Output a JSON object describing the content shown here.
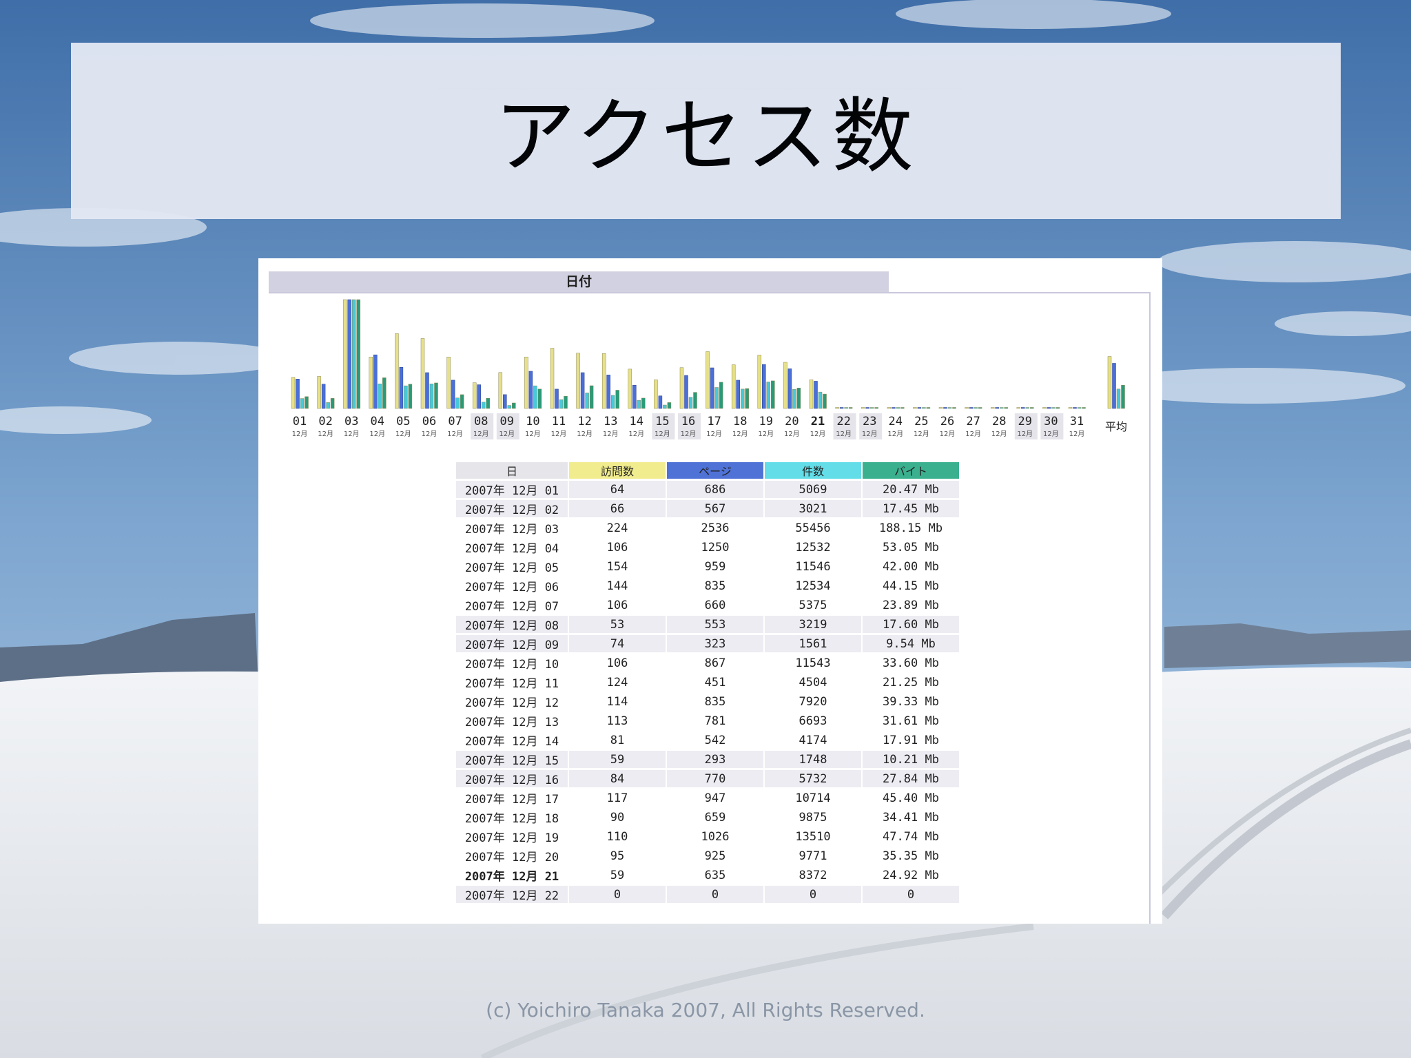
{
  "slide": {
    "title": "アクセス数",
    "footer": "(c) Yoichiro Tanaka 2007, All Rights Reserved."
  },
  "screenshot": {
    "date_header": "日付",
    "average_label": "平均",
    "month_label": "12月"
  },
  "colors": {
    "visits": "#e6e08a",
    "pages": "#4a6fd8",
    "hits": "#48c9d8",
    "bytes": "#2a9a78",
    "header_visits": "#f1ec8e",
    "header_pages": "#4f72d6",
    "header_hits": "#63dde8",
    "header_bytes": "#3ab08f"
  },
  "chart_data": {
    "type": "bar",
    "title": "",
    "categories": [
      "01",
      "02",
      "03",
      "04",
      "05",
      "06",
      "07",
      "08",
      "09",
      "10",
      "11",
      "12",
      "13",
      "14",
      "15",
      "16",
      "17",
      "18",
      "19",
      "20",
      "21",
      "22",
      "23",
      "24",
      "25",
      "26",
      "27",
      "28",
      "29",
      "30",
      "31"
    ],
    "series": [
      {
        "name": "訪問数",
        "values": [
          64,
          66,
          224,
          106,
          154,
          144,
          106,
          53,
          74,
          106,
          124,
          114,
          113,
          81,
          59,
          84,
          117,
          90,
          110,
          95,
          59,
          0,
          0,
          0,
          0,
          0,
          0,
          0,
          0,
          0,
          0
        ]
      },
      {
        "name": "ページ",
        "values": [
          686,
          567,
          2536,
          1250,
          959,
          835,
          660,
          553,
          323,
          867,
          451,
          835,
          781,
          542,
          293,
          770,
          947,
          659,
          1026,
          925,
          635,
          0,
          0,
          0,
          0,
          0,
          0,
          0,
          0,
          0,
          0
        ]
      },
      {
        "name": "件数",
        "values": [
          5069,
          3021,
          55456,
          12532,
          11546,
          12534,
          5375,
          3219,
          1561,
          11543,
          4504,
          7920,
          6693,
          4174,
          1748,
          5732,
          10714,
          9875,
          13510,
          9771,
          8372,
          0,
          0,
          0,
          0,
          0,
          0,
          0,
          0,
          0,
          0
        ]
      },
      {
        "name": "バイト",
        "values": [
          20.47,
          17.45,
          188.15,
          53.05,
          42.0,
          44.15,
          23.89,
          17.6,
          9.54,
          33.6,
          21.25,
          39.33,
          31.61,
          17.91,
          10.21,
          27.84,
          45.4,
          34.41,
          47.74,
          35.35,
          24.92,
          0,
          0,
          0,
          0,
          0,
          0,
          0,
          0,
          0,
          0
        ]
      }
    ],
    "average": {
      "visits": 107,
      "pages": 1052,
      "hits": 9912,
      "bytes": 40.18
    },
    "table_header": {
      "day": "日",
      "visits": "訪問数",
      "pages": "ページ",
      "hits": "件数",
      "bytes": "バイト"
    },
    "table_rows": [
      {
        "day": "2007年 12月 01",
        "visits": "64",
        "pages": "686",
        "hits": "5069",
        "bytes": "20.47 Mb"
      },
      {
        "day": "2007年 12月 02",
        "visits": "66",
        "pages": "567",
        "hits": "3021",
        "bytes": "17.45 Mb"
      },
      {
        "day": "2007年 12月 03",
        "visits": "224",
        "pages": "2536",
        "hits": "55456",
        "bytes": "188.15 Mb"
      },
      {
        "day": "2007年 12月 04",
        "visits": "106",
        "pages": "1250",
        "hits": "12532",
        "bytes": "53.05 Mb"
      },
      {
        "day": "2007年 12月 05",
        "visits": "154",
        "pages": "959",
        "hits": "11546",
        "bytes": "42.00 Mb"
      },
      {
        "day": "2007年 12月 06",
        "visits": "144",
        "pages": "835",
        "hits": "12534",
        "bytes": "44.15 Mb"
      },
      {
        "day": "2007年 12月 07",
        "visits": "106",
        "pages": "660",
        "hits": "5375",
        "bytes": "23.89 Mb"
      },
      {
        "day": "2007年 12月 08",
        "visits": "53",
        "pages": "553",
        "hits": "3219",
        "bytes": "17.60 Mb"
      },
      {
        "day": "2007年 12月 09",
        "visits": "74",
        "pages": "323",
        "hits": "1561",
        "bytes": "9.54 Mb"
      },
      {
        "day": "2007年 12月 10",
        "visits": "106",
        "pages": "867",
        "hits": "11543",
        "bytes": "33.60 Mb"
      },
      {
        "day": "2007年 12月 11",
        "visits": "124",
        "pages": "451",
        "hits": "4504",
        "bytes": "21.25 Mb"
      },
      {
        "day": "2007年 12月 12",
        "visits": "114",
        "pages": "835",
        "hits": "7920",
        "bytes": "39.33 Mb"
      },
      {
        "day": "2007年 12月 13",
        "visits": "113",
        "pages": "781",
        "hits": "6693",
        "bytes": "31.61 Mb"
      },
      {
        "day": "2007年 12月 14",
        "visits": "81",
        "pages": "542",
        "hits": "4174",
        "bytes": "17.91 Mb"
      },
      {
        "day": "2007年 12月 15",
        "visits": "59",
        "pages": "293",
        "hits": "1748",
        "bytes": "10.21 Mb"
      },
      {
        "day": "2007年 12月 16",
        "visits": "84",
        "pages": "770",
        "hits": "5732",
        "bytes": "27.84 Mb"
      },
      {
        "day": "2007年 12月 17",
        "visits": "117",
        "pages": "947",
        "hits": "10714",
        "bytes": "45.40 Mb"
      },
      {
        "day": "2007年 12月 18",
        "visits": "90",
        "pages": "659",
        "hits": "9875",
        "bytes": "34.41 Mb"
      },
      {
        "day": "2007年 12月 19",
        "visits": "110",
        "pages": "1026",
        "hits": "13510",
        "bytes": "47.74 Mb"
      },
      {
        "day": "2007年 12月 20",
        "visits": "95",
        "pages": "925",
        "hits": "9771",
        "bytes": "35.35 Mb"
      },
      {
        "day": "2007年 12月 21",
        "visits": "59",
        "pages": "635",
        "hits": "8372",
        "bytes": "24.92 Mb"
      },
      {
        "day": "2007年 12月 22",
        "visits": "0",
        "pages": "0",
        "hits": "0",
        "bytes": "0"
      }
    ]
  }
}
